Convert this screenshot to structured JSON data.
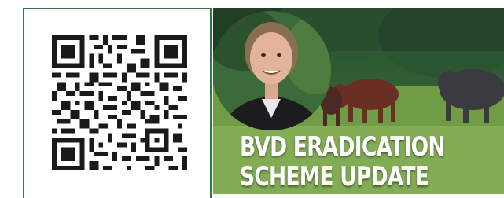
{
  "qr": {
    "icon": "qr-code-icon",
    "border_color": "#2f7a4a"
  },
  "thumbnail": {
    "headline_line1": "BVD ERADICATION",
    "headline_line2": "SCHEME UPDATE"
  }
}
